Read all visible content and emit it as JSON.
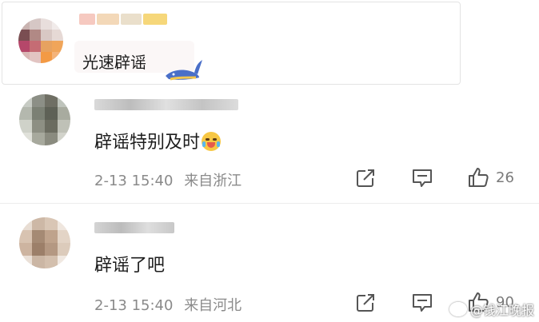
{
  "quoted_comment": {
    "text": "光速辟谣"
  },
  "comments": [
    {
      "text": "辟谣特别及时",
      "emoji_icon": "crying-laughing-emoji-icon",
      "timestamp": "2-13 15:40",
      "location": "来自浙江",
      "like_count": "26"
    },
    {
      "text": "辟谣了吧",
      "timestamp": "2-13 15:40",
      "location": "来自河北",
      "like_count": "90"
    }
  ],
  "watermark": {
    "text": "@钱江晚报"
  },
  "colors": {
    "meta_text": "#8a8a8a",
    "icon_stroke": "#555555"
  }
}
